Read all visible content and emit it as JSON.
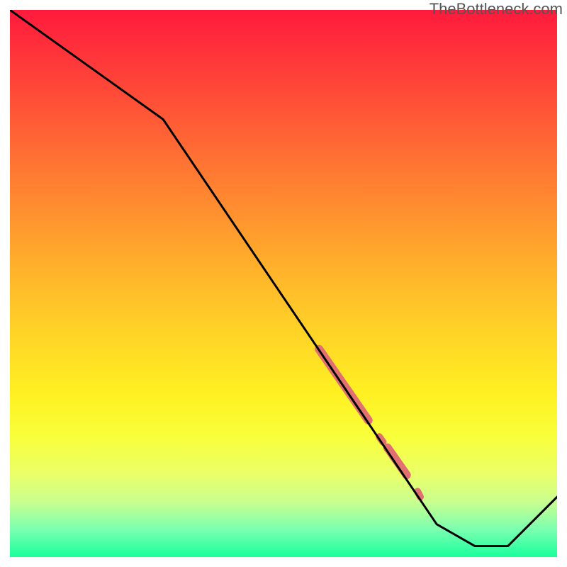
{
  "watermark": "TheBottleneck.com",
  "chart_data": {
    "type": "line",
    "title": "",
    "xlabel": "",
    "ylabel": "",
    "xlim": [
      0,
      100
    ],
    "ylim": [
      0,
      100
    ],
    "series": [
      {
        "name": "bottleneck-curve",
        "color": "#000000",
        "x": [
          0,
          28,
          78,
          85,
          91,
          100
        ],
        "values": [
          100,
          80,
          6,
          2,
          2,
          11
        ]
      }
    ],
    "highlights": [
      {
        "name": "highlight-upper-thick",
        "color": "#e27070",
        "width": 12,
        "x": [
          56.5,
          65.5
        ],
        "values": [
          38,
          25
        ]
      },
      {
        "name": "highlight-gap-dot-1",
        "color": "#e27070",
        "width": 10,
        "x": [
          67.5,
          68.2
        ],
        "values": [
          22,
          21
        ]
      },
      {
        "name": "highlight-lower-thick",
        "color": "#e27070",
        "width": 12,
        "x": [
          69.0,
          72.5
        ],
        "values": [
          20,
          15
        ]
      },
      {
        "name": "highlight-gap-dot-2",
        "color": "#e27070",
        "width": 10,
        "x": [
          74.5,
          75.0
        ],
        "values": [
          12,
          11
        ]
      }
    ],
    "background": {
      "type": "vertical-gradient",
      "top_color": "#ff1a3c",
      "bottom_color": "#19ff9c",
      "note": "red at top through orange/yellow to green at bottom"
    }
  }
}
